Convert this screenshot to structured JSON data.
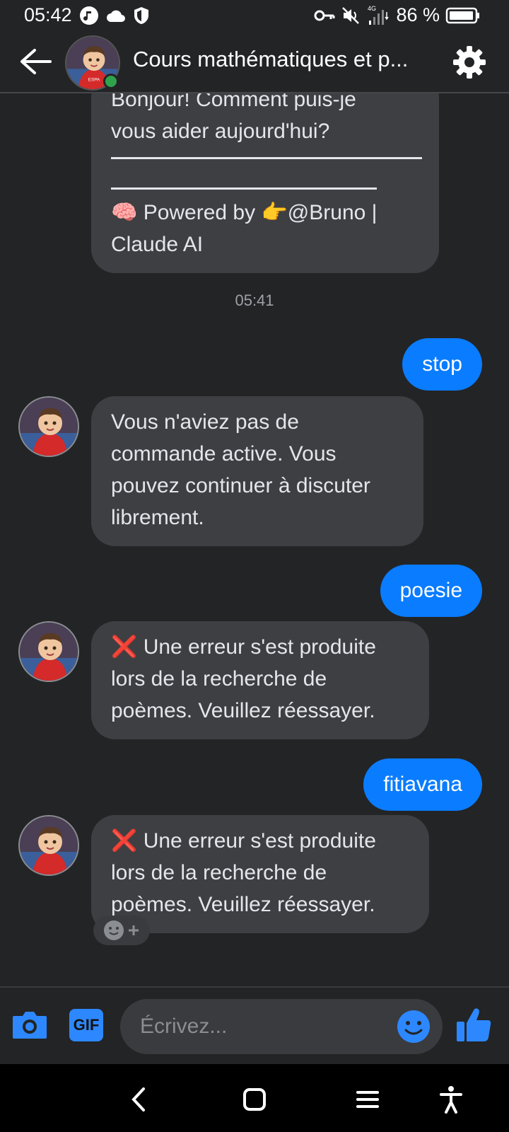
{
  "status_bar": {
    "time": "05:42",
    "battery": "86 %",
    "network": "4G"
  },
  "header": {
    "title": "Cours mathématiques et p...",
    "avatar_badge": "ESPA"
  },
  "messages": [
    {
      "direction": "incoming",
      "lines": [
        "Bonjour! Comment puis-je",
        "vous aider aujourd'hui?"
      ],
      "footer_lines": [
        "🧠 Powered by 👉@Bruno |",
        "Claude AI"
      ]
    },
    {
      "direction": "timestamp",
      "text": "05:41"
    },
    {
      "direction": "outgoing",
      "text": "stop"
    },
    {
      "direction": "incoming",
      "lines": [
        "Vous n'aviez pas de",
        "commande active. Vous",
        "pouvez continuer à discuter",
        "librement."
      ]
    },
    {
      "direction": "outgoing",
      "text": "poesie"
    },
    {
      "direction": "incoming",
      "lines": [
        "❌ Une erreur s'est produite",
        "lors de la recherche de",
        "poèmes. Veuillez réessayer."
      ]
    },
    {
      "direction": "outgoing",
      "text": "fitiavana"
    },
    {
      "direction": "incoming",
      "lines": [
        "❌ Une erreur s'est produite",
        "lors de la recherche de",
        "poèmes. Veuillez réessayer."
      ]
    }
  ],
  "composer": {
    "placeholder": "Écrivez...",
    "gif_label": "GIF"
  },
  "colors": {
    "background": "#232426",
    "incoming_bubble": "#3e3f42",
    "outgoing_bubble": "#0a7cff",
    "accent": "#2d88ff",
    "online": "#31a24c"
  }
}
